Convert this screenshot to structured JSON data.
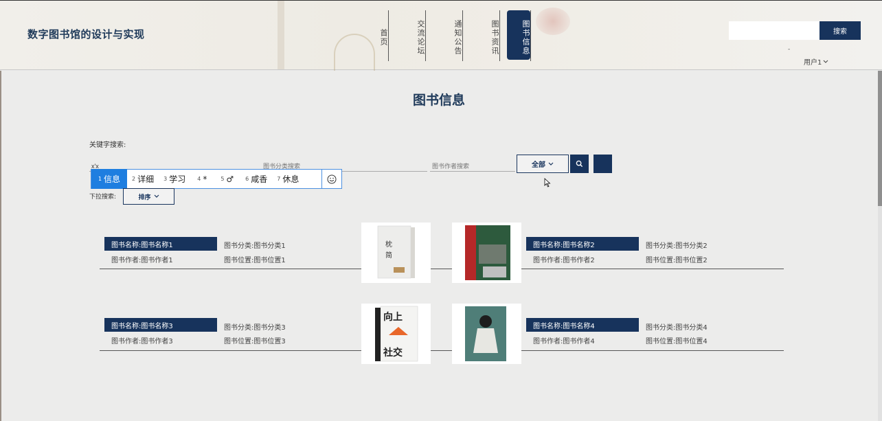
{
  "header": {
    "site_title": "数字图书馆的设计与实现",
    "nav": [
      "首页",
      "交流论坛",
      "通知公告",
      "图书资讯",
      "图书信息"
    ],
    "search_placeholder": "",
    "search_label": "搜索",
    "user_label": "用户1"
  },
  "main": {
    "page_title": "图书信息",
    "keyword_label": "关键字搜索:",
    "keyword_value": "x'x",
    "category_placeholder": "图书分类搜索",
    "author_placeholder": "图书作者搜索",
    "all_button": "全部",
    "dropdown_label": "下拉搜索:",
    "sort_button": "排序"
  },
  "ime": {
    "candidates": [
      {
        "num": "1",
        "text": "信息"
      },
      {
        "num": "2",
        "text": "详细"
      },
      {
        "num": "3",
        "text": "学习"
      },
      {
        "num": "4",
        "text": "*"
      },
      {
        "num": "5",
        "text": "♂"
      },
      {
        "num": "6",
        "text": "咸香"
      },
      {
        "num": "7",
        "text": "休息"
      }
    ]
  },
  "books": [
    {
      "name": "图书名称:图书名称1",
      "author": "图书作者:图书作者1",
      "category": "图书分类:图书分类1",
      "location": "图书位置:图书位置1",
      "cover": "枕 简"
    },
    {
      "name": "图书名称:图书名称2",
      "author": "图书作者:图书作者2",
      "category": "图书分类:图书分类2",
      "location": "图书位置:图书位置2",
      "cover": ""
    },
    {
      "name": "图书名称:图书名称3",
      "author": "图书作者:图书作者3",
      "category": "图书分类:图书分类3",
      "location": "图书位置:图书位置3",
      "cover": "向上社交"
    },
    {
      "name": "图书名称:图书名称4",
      "author": "图书作者:图书作者4",
      "category": "图书分类:图书分类4",
      "location": "图书位置:图书位置4",
      "cover": ""
    }
  ]
}
